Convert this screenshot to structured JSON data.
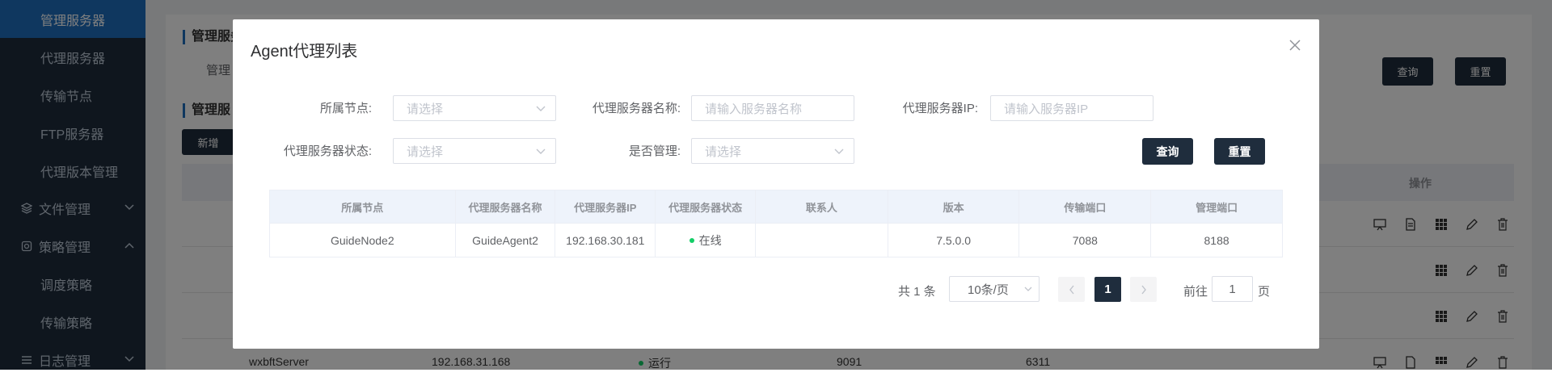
{
  "sidebar": {
    "items": [
      {
        "label": "管理服务器",
        "active": true
      },
      {
        "label": "代理服务器"
      },
      {
        "label": "传输节点"
      },
      {
        "label": "FTP服务器"
      },
      {
        "label": "代理版本管理"
      },
      {
        "label": "文件管理",
        "group": true
      },
      {
        "label": "策略管理",
        "group": true
      },
      {
        "label": "调度策略"
      },
      {
        "label": "传输策略"
      },
      {
        "label": "日志管理",
        "group": true
      }
    ]
  },
  "background": {
    "section1_title": "管理服务",
    "section1_label": "管理",
    "section2_title": "管理服",
    "add_button": "新增",
    "query_button": "查询",
    "reset_button": "重置",
    "ops_header": "操作",
    "last_row": {
      "name": "wxbftServer",
      "ip": "192.168.31.168",
      "status": "运行",
      "port1": "9091",
      "port2": "6311"
    }
  },
  "modal": {
    "title": "Agent代理列表",
    "filters": {
      "node_label": "所属节点:",
      "node_placeholder": "请选择",
      "name_label": "代理服务器名称:",
      "name_placeholder": "请输入服务器名称",
      "ip_label": "代理服务器IP:",
      "ip_placeholder": "请输入服务器IP",
      "status_label": "代理服务器状态:",
      "status_placeholder": "请选择",
      "managed_label": "是否管理:",
      "managed_placeholder": "请选择"
    },
    "query_button": "查询",
    "reset_button": "重置",
    "table": {
      "headers": [
        "所属节点",
        "代理服务器名称",
        "代理服务器IP",
        "代理服务器状态",
        "联系人",
        "版本",
        "传输端口",
        "管理端口"
      ],
      "rows": [
        {
          "node": "GuideNode2",
          "name": "GuideAgent2",
          "ip": "192.168.30.181",
          "status": "在线",
          "contact": "",
          "version": "7.5.0.0",
          "transfer_port": "7088",
          "manage_port": "8188"
        }
      ]
    },
    "pagination": {
      "total": "共 1 条",
      "page_size": "10条/页",
      "current_page": "1",
      "goto_label": "前往",
      "goto_value": "1",
      "page_suffix": "页"
    }
  },
  "colors": {
    "accent": "#1f6fbf",
    "dark": "#1f2d3d",
    "online": "#13ce66"
  }
}
